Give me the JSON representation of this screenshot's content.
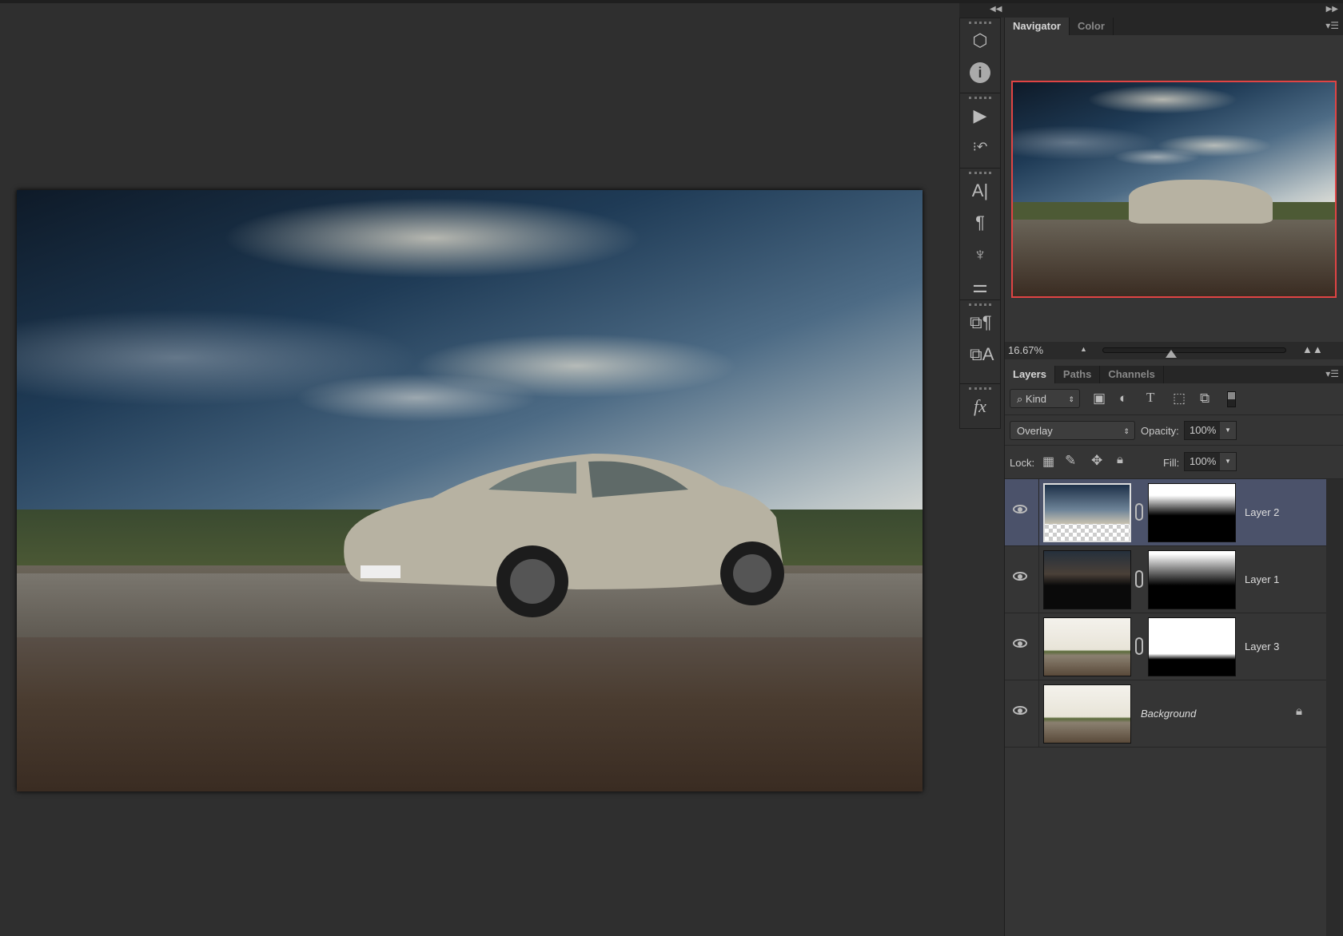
{
  "canvas": {
    "document": "car-photo"
  },
  "toolstrip": {
    "collapse_icon": "double-chevron-left",
    "expand_icon": "double-chevron-right",
    "groups": [
      [
        "3d-icon",
        "info-icon"
      ],
      [
        "actions-play-icon",
        "history-icon"
      ],
      [
        "character-icon",
        "paragraph-icon",
        "brushes-icon",
        "brush-presets-icon"
      ],
      [
        "paragraph-styles-icon",
        "character-styles-icon"
      ],
      [
        "styles-fx-icon"
      ]
    ]
  },
  "navigator": {
    "tabs": [
      "Navigator",
      "Color"
    ],
    "active_tab": "Navigator",
    "zoom": "16.67%",
    "viewbox_color": "#e04444"
  },
  "layers_panel": {
    "tabs": [
      "Layers",
      "Paths",
      "Channels"
    ],
    "active_tab": "Layers",
    "filter": {
      "label": "Kind"
    },
    "blend_mode": "Overlay",
    "opacity_label": "Opacity:",
    "opacity": "100%",
    "lock_label": "Lock:",
    "fill_label": "Fill:",
    "fill": "100%",
    "layers": [
      {
        "name": "Layer 2",
        "selected": true,
        "visible": true,
        "has_mask": true
      },
      {
        "name": "Layer 1",
        "selected": false,
        "visible": true,
        "has_mask": true
      },
      {
        "name": "Layer 3",
        "selected": false,
        "visible": true,
        "has_mask": true
      },
      {
        "name": "Background",
        "selected": false,
        "visible": true,
        "locked": true
      }
    ]
  },
  "colors": {
    "selected_layer": "#4b526a",
    "panel": "#353535"
  }
}
